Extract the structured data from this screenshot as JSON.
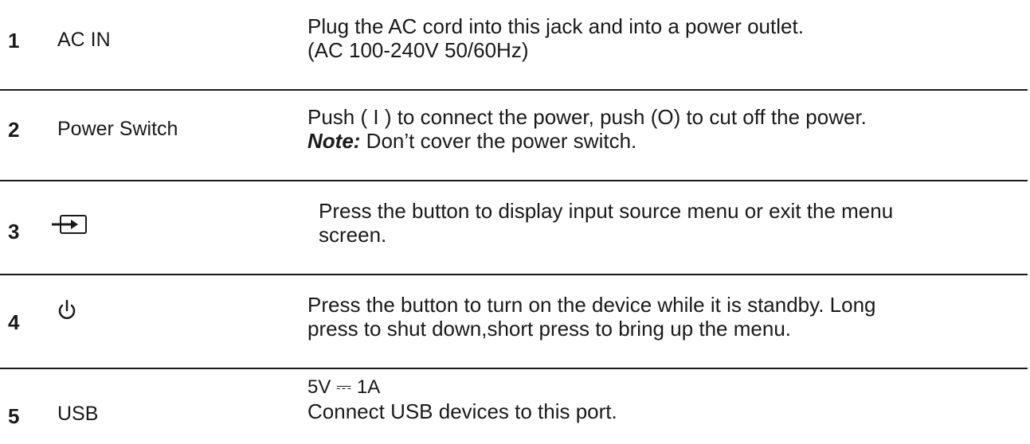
{
  "rows": [
    {
      "number": "1",
      "name": "AC IN",
      "desc_line1": "Plug the AC cord into this jack and into a power outlet.",
      "desc_line2": "(AC 100-240V 50/60Hz)"
    },
    {
      "number": "2",
      "name": "Power Switch",
      "desc_line1": "Push ( I ) to connect the power, push (O) to cut off the power.",
      "note_label": "Note:",
      "note_text": "Don’t  cover the power switch."
    },
    {
      "number": "3",
      "icon": "input-source-icon",
      "desc_line1": "Press the button to display input source menu or exit the menu",
      "desc_line2": "screen."
    },
    {
      "number": "4",
      "icon": "power-icon",
      "desc_line1": "Press the button to turn on the device while it is standby. Long",
      "desc_line2": "press to shut down,short press to bring up the menu."
    },
    {
      "number": "5",
      "name": "USB",
      "desc_line1": "5V ⎓ 1A",
      "desc_line2": "Connect USB devices to this port."
    }
  ]
}
